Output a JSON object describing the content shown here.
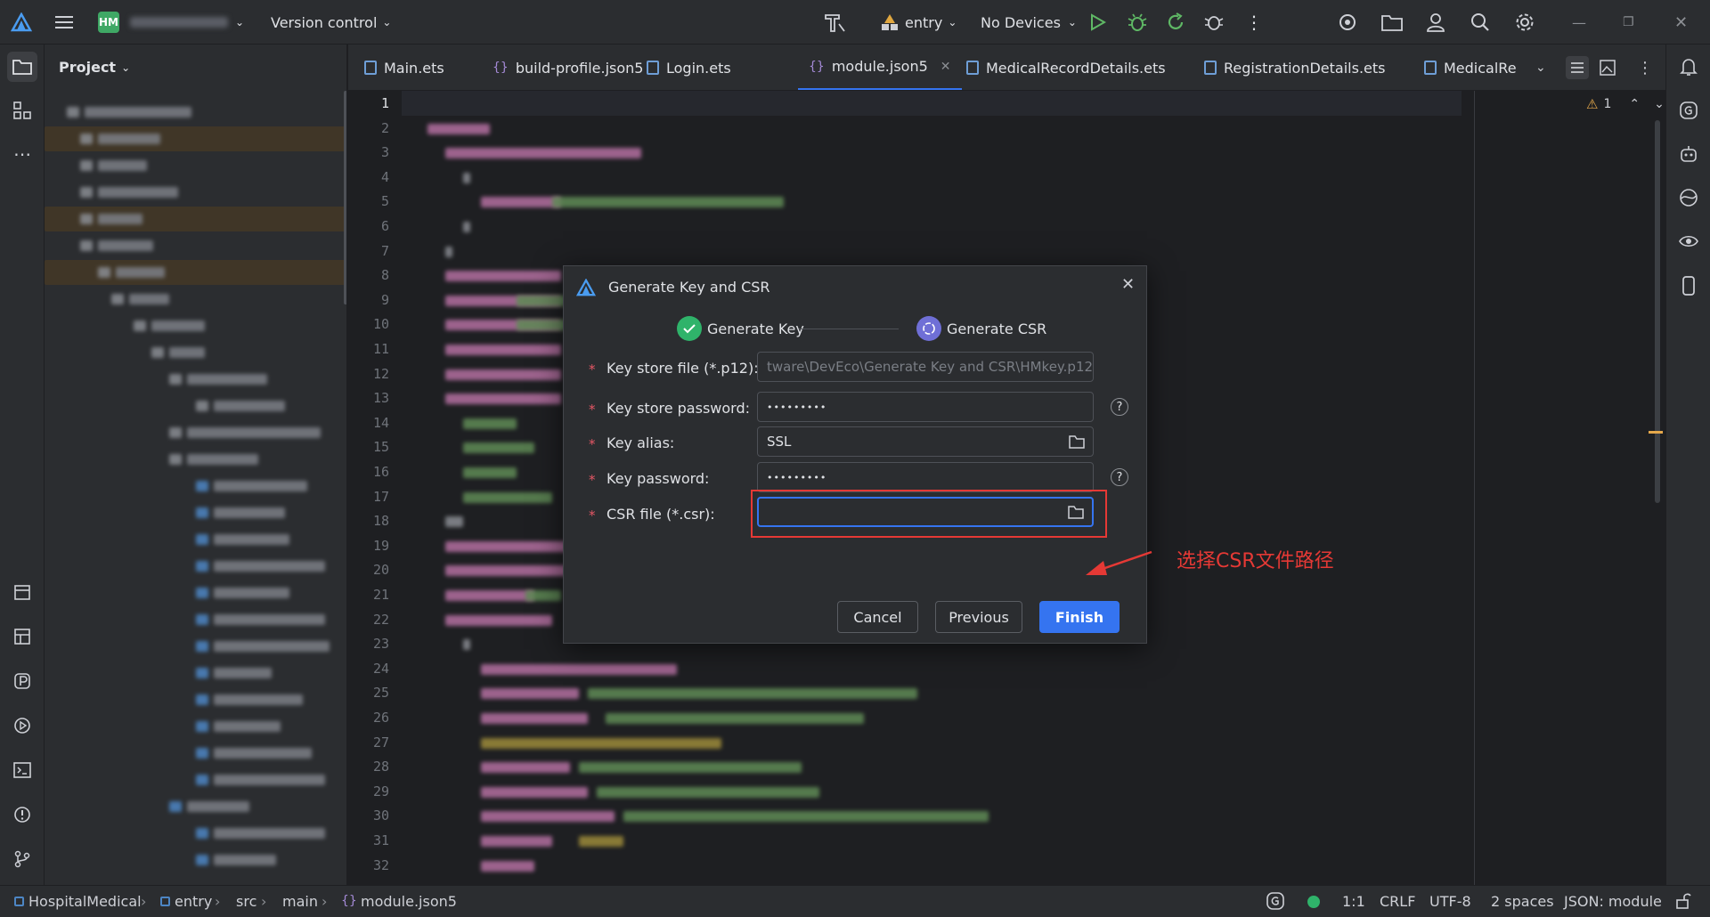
{
  "titlebar": {
    "project_badge": "HM",
    "version_control": "Version control",
    "run_config": "entry",
    "devices": "No Devices"
  },
  "tool_window": {
    "title": "Project"
  },
  "tabs": [
    {
      "label": "Main.ets",
      "icon": "ets-file-icon"
    },
    {
      "label": "build-profile.json5",
      "icon": "json-file-icon"
    },
    {
      "label": "Login.ets",
      "icon": "ets-file-icon"
    },
    {
      "label": "module.json5",
      "icon": "json-file-icon",
      "active": true
    },
    {
      "label": "MedicalRecordDetails.ets",
      "icon": "ets-file-icon"
    },
    {
      "label": "RegistrationDetails.ets",
      "icon": "ets-file-icon"
    },
    {
      "label": "MedicalRe",
      "icon": "ets-file-icon"
    }
  ],
  "editor": {
    "warnings": "1",
    "line_numbers": [
      "1",
      "2",
      "3",
      "4",
      "5",
      "6",
      "7",
      "8",
      "9",
      "10",
      "11",
      "12",
      "13",
      "14",
      "15",
      "16",
      "17",
      "18",
      "19",
      "20",
      "21",
      "22",
      "23",
      "24",
      "25",
      "26",
      "27",
      "28",
      "29",
      "30",
      "31",
      "32"
    ]
  },
  "dialog": {
    "title": "Generate Key and CSR",
    "step1": "Generate Key",
    "step2": "Generate CSR",
    "fields": {
      "keystore_label": "Key store file (*.p12):",
      "keystore_value": "tware\\DevEco\\Generate Key and CSR\\HMkey.p12",
      "keystore_password_label": "Key store password:",
      "keystore_password_value": "•••••••••",
      "alias_label": "Key alias:",
      "alias_value": "SSL",
      "key_password_label": "Key password:",
      "key_password_value": "•••••••••",
      "csr_label": "CSR file (*.csr):",
      "csr_value": ""
    },
    "required_mark": "*",
    "help_mark": "?",
    "buttons": {
      "cancel": "Cancel",
      "previous": "Previous",
      "finish": "Finish"
    }
  },
  "annotation": {
    "text": "选择CSR文件路径",
    "color": "#e53935"
  },
  "breadcrumb": [
    "HospitalMedical",
    "entry",
    "src",
    "main",
    "module.json5"
  ],
  "status": {
    "position": "1:1",
    "line_ending": "CRLF",
    "encoding": "UTF-8",
    "indent": "2 spaces",
    "file_type": "JSON: module"
  },
  "colors": {
    "accent": "#3574f0",
    "success": "#2fb36a",
    "annotation": "#e53935"
  }
}
